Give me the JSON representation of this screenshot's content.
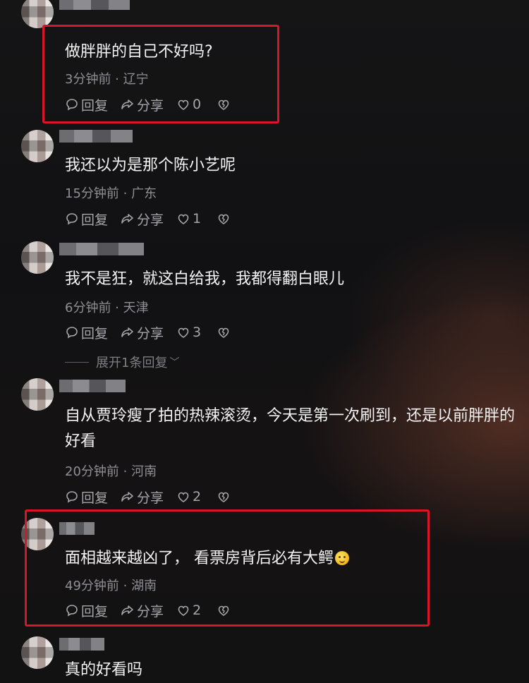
{
  "comments": [
    {
      "text": "做胖胖的自己不好吗?",
      "meta": "3分钟前 · 辽宁",
      "reply_label": "回复",
      "share_label": "分享",
      "like_count": "0"
    },
    {
      "text": "我还以为是那个陈小艺呢",
      "meta": "15分钟前 · 广东",
      "reply_label": "回复",
      "share_label": "分享",
      "like_count": "1"
    },
    {
      "text": "我不是狂，就这白给我，我都得翻白眼儿",
      "meta": "6分钟前 · 天津",
      "reply_label": "回复",
      "share_label": "分享",
      "like_count": "3",
      "expand_label": "展开1条回复"
    },
    {
      "text": "自从贾玲瘦了拍的热辣滚烫，今天是第一次刷到，还是以前胖胖的好看",
      "meta": "20分钟前 · 河南",
      "reply_label": "回复",
      "share_label": "分享",
      "like_count": "2"
    },
    {
      "text": "面相越来越凶了， 看票房背后必有大鳄",
      "meta": "49分钟前 · 湖南",
      "reply_label": "回复",
      "share_label": "分享",
      "like_count": "2"
    },
    {
      "text": "真的好看吗"
    }
  ],
  "colors": {
    "highlight_border": "#d8152b",
    "meta_text": "#8f8f95",
    "action_text": "#a5a5ab"
  },
  "icons": [
    "comment-bubble-icon",
    "share-arrow-icon",
    "heart-icon",
    "broken-heart-icon",
    "chevron-down-icon",
    "smiley-emoji-icon"
  ]
}
